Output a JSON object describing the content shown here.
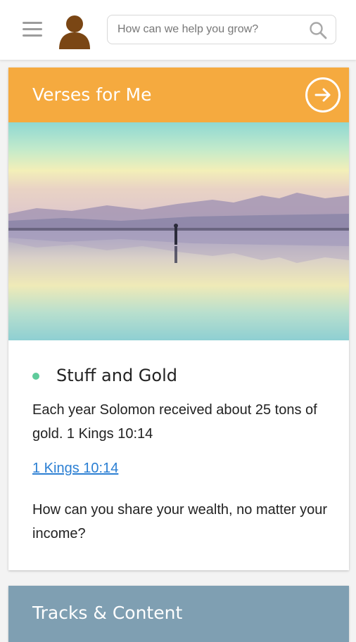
{
  "header": {
    "search_placeholder": "How can we help you grow?",
    "menu_icon": "hamburger-menu-icon",
    "avatar_icon": "user-avatar-icon",
    "search_icon": "search-icon"
  },
  "verses_card": {
    "title": "Verses for Me",
    "header_color": "#F5AA3F",
    "arrow_icon": "arrow-right-circle-icon",
    "verse": {
      "title": "Stuff and Gold",
      "dot_color": "#5FCB9B",
      "text": "Each year Solomon received about 25 tons of gold. 1 Kings 10:14",
      "reference_link": "1 Kings 10:14",
      "question": "How can you share your wealth, no matter your income?"
    }
  },
  "tracks_card": {
    "title": "Tracks & Content",
    "header_color": "#7F9FB2"
  },
  "colors": {
    "link": "#2B7FD3",
    "avatar": "#7A4614"
  }
}
